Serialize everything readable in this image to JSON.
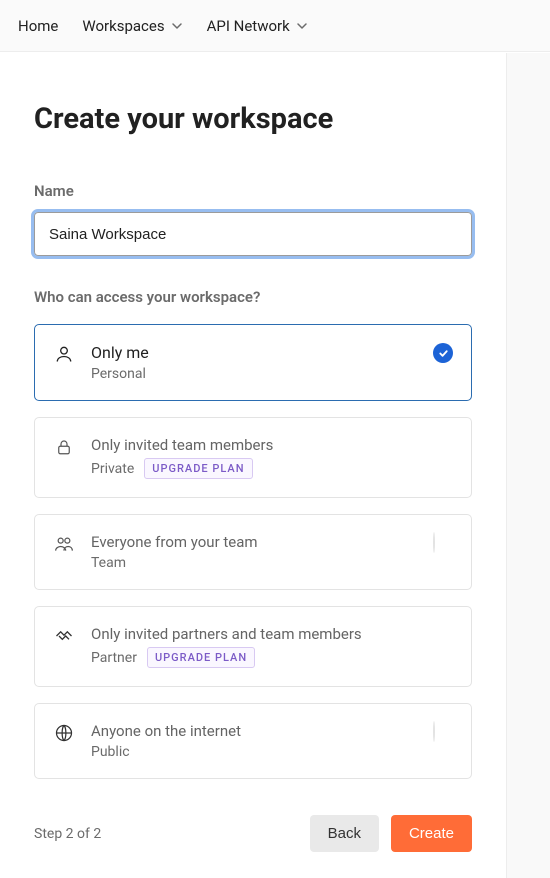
{
  "nav": {
    "home": "Home",
    "workspaces": "Workspaces",
    "api_network": "API Network"
  },
  "page": {
    "title": "Create your workspace",
    "name_label": "Name",
    "name_value": "Saina Workspace",
    "access_label": "Who can access your workspace?"
  },
  "options": [
    {
      "title": "Only me",
      "subtitle": "Personal",
      "upgrade": false,
      "selected": true,
      "icon": "person"
    },
    {
      "title": "Only invited team members",
      "subtitle": "Private",
      "upgrade": true,
      "selected": false,
      "icon": "lock"
    },
    {
      "title": "Everyone from your team",
      "subtitle": "Team",
      "upgrade": false,
      "selected": false,
      "icon": "people",
      "radio": true
    },
    {
      "title": "Only invited partners and team members",
      "subtitle": "Partner",
      "upgrade": true,
      "selected": false,
      "icon": "handshake"
    },
    {
      "title": "Anyone on the internet",
      "subtitle": "Public",
      "upgrade": false,
      "selected": false,
      "icon": "globe",
      "radio": true
    }
  ],
  "upgrade_label": "UPGRADE PLAN",
  "footer": {
    "step": "Step 2 of 2",
    "back": "Back",
    "create": "Create"
  }
}
